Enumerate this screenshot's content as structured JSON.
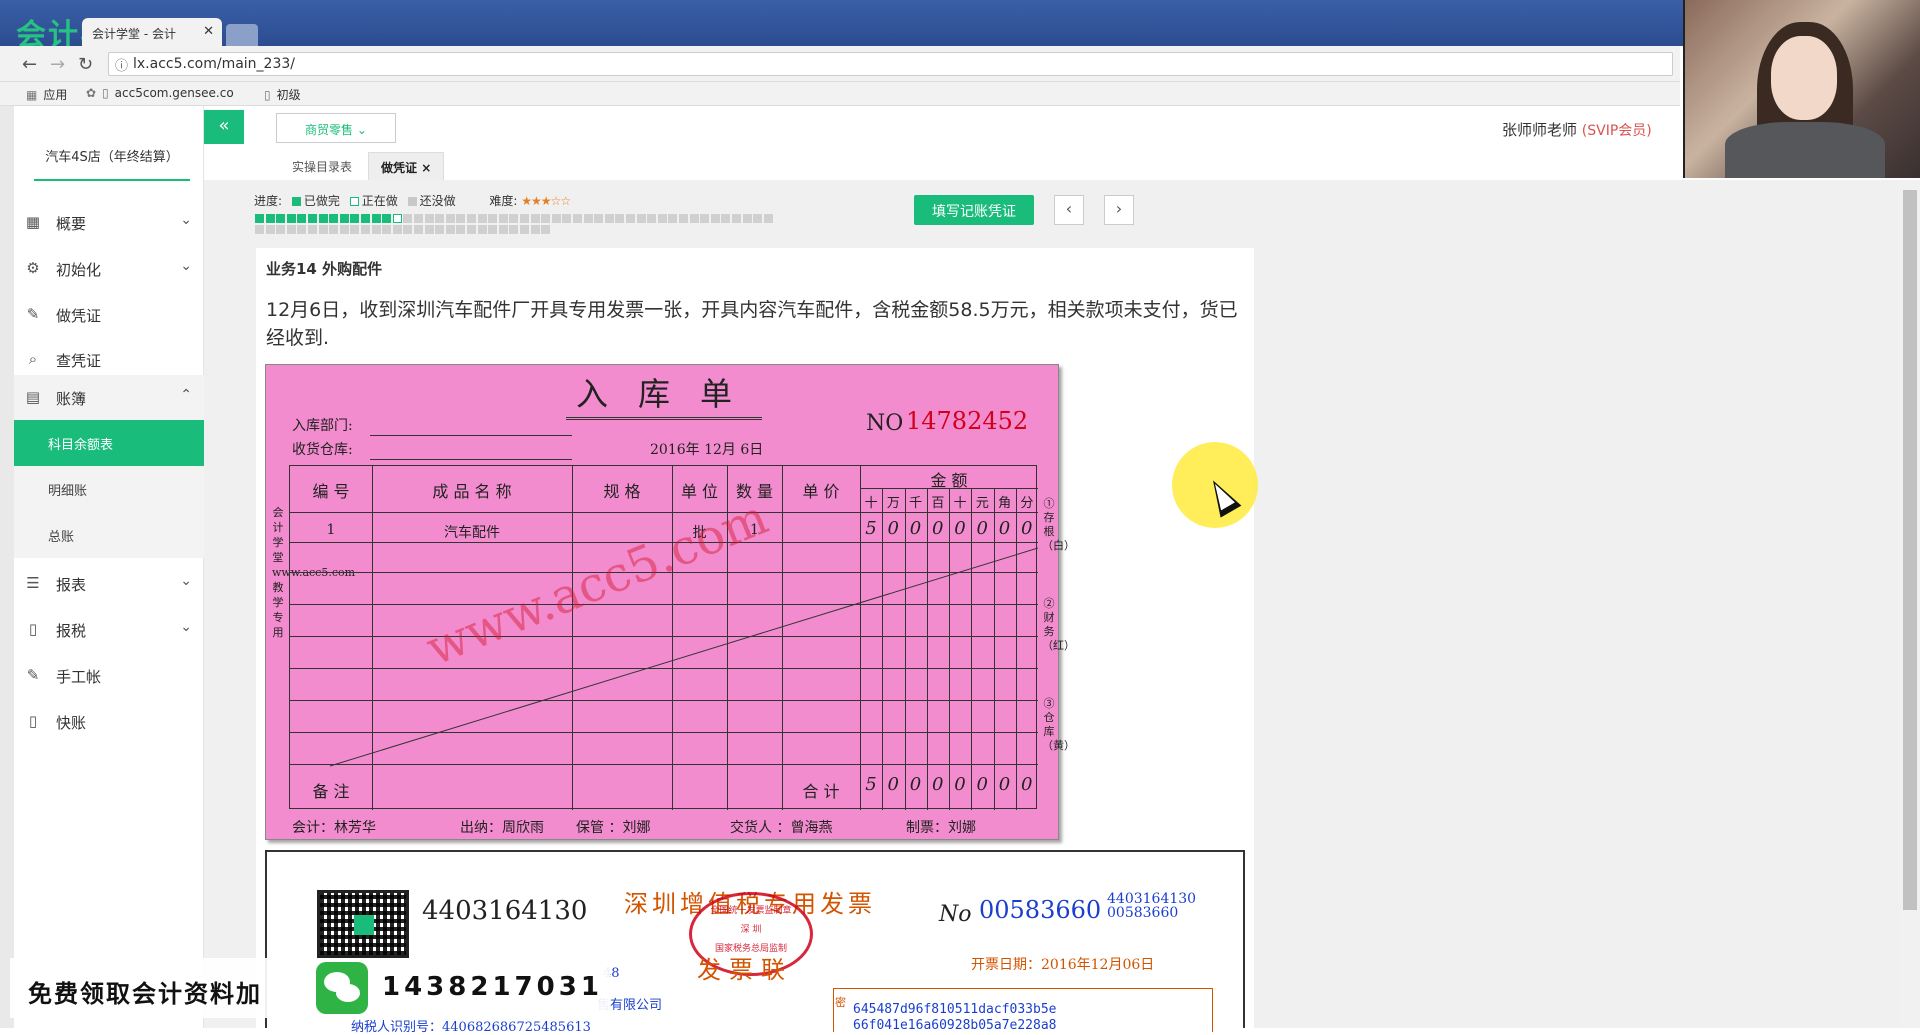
{
  "browser": {
    "logo_text": "会计学堂",
    "tab_title": "会计学堂 - 会计",
    "url": "lx.acc5.com/main_233/",
    "bookmarks": [
      "应用",
      "acc5com.gensee.co",
      "初级"
    ]
  },
  "header": {
    "industry_label": "商贸零售",
    "user_name": "张师师老师",
    "user_level": "(SVIP会员)"
  },
  "sidebar": {
    "company": "汽车4S店（年终结算）",
    "items": [
      {
        "label": "概要",
        "icon": "grid-icon"
      },
      {
        "label": "初始化",
        "icon": "gear-icon"
      },
      {
        "label": "做凭证",
        "icon": "pen-icon"
      },
      {
        "label": "查凭证",
        "icon": "search-icon"
      },
      {
        "label": "账簿",
        "icon": "book-icon"
      },
      {
        "label": "报表",
        "icon": "list-icon"
      },
      {
        "label": "报税",
        "icon": "file-icon"
      },
      {
        "label": "手工帐",
        "icon": "pen-icon"
      },
      {
        "label": "快账",
        "icon": "file-icon"
      }
    ],
    "submenu": [
      "科目余额表",
      "明细账",
      "总账"
    ],
    "active_submenu": "科目余额表"
  },
  "subtabs": [
    "实操目录表",
    "做凭证"
  ],
  "progress": {
    "label": "进度:",
    "done_label": "已做完",
    "doing_label": "正在做",
    "todo_label": "还没做",
    "difficulty_label": "难度:",
    "difficulty_stars": "★★★☆☆",
    "done_count": 13,
    "current_index": 13,
    "total": 77,
    "colors": {
      "done": "#1abc7c",
      "doing": "#1abc7c",
      "todo": "#d0d0d0"
    }
  },
  "actions": {
    "fill_voucher": "填写记账凭证",
    "prev": "‹",
    "next": "›"
  },
  "business": {
    "title": "业务14 外购配件",
    "description": "12月6日，收到深圳汽车配件厂开具专用发票一张，开具内容汽车配件，含税金额58.5万元，相关款项未支付，货已经收到."
  },
  "receipt": {
    "title": "入库单",
    "no_label": "NO",
    "no": "14782452",
    "dept_label": "入库部门:",
    "warehouse_label": "收货仓库:",
    "date": "2016年 12月 6日",
    "headers": [
      "编 号",
      "成 品 名 称",
      "规 格",
      "单 位",
      "数 量",
      "单 价"
    ],
    "amount_header": "金   额",
    "amount_units": [
      "十",
      "万",
      "千",
      "百",
      "十",
      "元",
      "角",
      "分"
    ],
    "row": {
      "no": "1",
      "name": "汽车配件",
      "unit": "批",
      "qty": "1",
      "amount_digits": [
        "5",
        "0",
        "0",
        "0",
        "0",
        "0",
        "0",
        "0"
      ]
    },
    "remark_label": "备 注",
    "total_label": "合 计",
    "total_digits": [
      "5",
      "0",
      "0",
      "0",
      "0",
      "0",
      "0",
      "0"
    ],
    "side_text": "会计学堂www.acc5.com教学专用",
    "right_notes": [
      "①存根（白）",
      "②财务（红）",
      "③仓库（黄）"
    ],
    "watermark": "www.acc5.com",
    "footer": {
      "accountant": "会计：林芳华",
      "cashier": "出纳：周欣雨",
      "keeper": "保管 ：刘娜",
      "deliverer": "交货人 ：曾海燕",
      "maker": "制票：刘娜"
    }
  },
  "invoice": {
    "code": "4403164130",
    "title": "深圳增值税专用发票",
    "subtitle": "发票联",
    "seal_top": "全国统一发票监制章",
    "seal_mid": "深 圳",
    "seal_bottom": "国家税务总局监制",
    "no_label": "No",
    "no": "00583660",
    "small_code": "4403164130",
    "small_no": "00583660",
    "date": "开票日期：2016年12月06日",
    "buyer_fragment": "售有限公司",
    "fragment_48": "48",
    "tax_id_fragment": "纳税人识别号：440682686725485613",
    "cipher_label": "密",
    "cipher": [
      "645487d96f810511dacf033b5e",
      "66f041e16a60928b05a7e228a8"
    ]
  },
  "promo": {
    "text": "免费领取会计资料加",
    "number": "1438217031"
  }
}
